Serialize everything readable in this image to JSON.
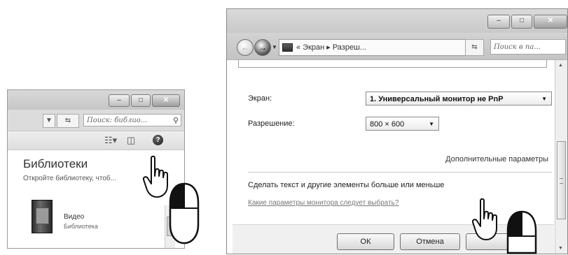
{
  "left_window": {
    "address": {
      "search_placeholder": "Поиск: библио..."
    },
    "libraries_title": "Библиотеки",
    "libraries_description": "Откройте библиотеку, чтоб...",
    "items": [
      {
        "name": "Видео",
        "subtitle": "Библиотека"
      }
    ]
  },
  "right_window": {
    "breadcrumb": "« Экран ▸ Разреш...",
    "search_placeholder": "Поиск в па...",
    "display_label": "Экран:",
    "display_value": "1. Универсальный монитор не PnP",
    "resolution_label": "Разрешение:",
    "resolution_value": "800 × 600",
    "advanced_link": "Дополнительные параметры",
    "text_size_link": "Сделать текст и другие элементы больше или меньше",
    "which_params_link": "Какие параметры монитора следует выбрать?",
    "ok_label": "ОК",
    "cancel_label": "Отмена"
  },
  "icons": [
    "help-icon",
    "search-icon",
    "refresh-icon",
    "view-options-icon",
    "preview-pane-icon",
    "video-library-icon",
    "hand-pointer-icon",
    "mouse-left-click-icon"
  ],
  "colors": {
    "window_chrome": "#c9c9c9",
    "toolbar": "#e4e4e4",
    "link_gray": "#777777"
  }
}
